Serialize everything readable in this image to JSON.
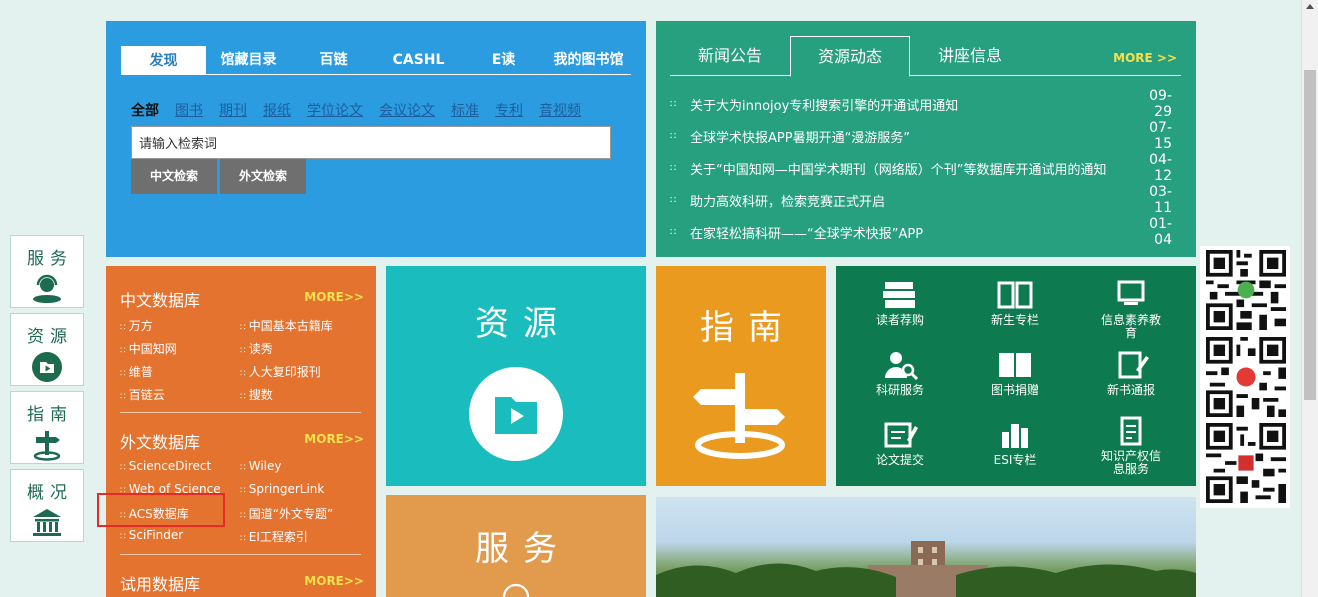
{
  "side_nav": [
    {
      "label": "服务",
      "icon": "service-icon"
    },
    {
      "label": "资源",
      "icon": "resource-icon"
    },
    {
      "label": "指南",
      "icon": "guide-icon"
    },
    {
      "label": "概况",
      "icon": "library-icon"
    }
  ],
  "search": {
    "tabs": [
      "发现",
      "馆藏目录",
      "百链",
      "CASHL",
      "E读",
      "我的图书馆"
    ],
    "types": [
      "全部",
      "图书",
      "期刊",
      "报纸",
      "学位论文",
      "会议论文",
      "标准",
      "专利",
      "音视频"
    ],
    "input_value": "请输入检索词",
    "btn_cn": "中文检索",
    "btn_foreign": "外文检索"
  },
  "news": {
    "tabs": [
      "新闻公告",
      "资源动态",
      "讲座信息"
    ],
    "more": "MORE >>",
    "items": [
      {
        "title": "关于大为innojoy专利搜索引擎的开通试用通知",
        "date": "09-29"
      },
      {
        "title": "全球学术快报APP暑期开通“漫游服务”",
        "date": "07-15"
      },
      {
        "title": "关于“中国知网—中国学术期刊（网络版）个刊”等数据库开通试用的通知",
        "date": "04-12"
      },
      {
        "title": "助力高效科研，检索竞赛正式开启",
        "date": "03-11"
      },
      {
        "title": "在家轻松搞科研——“全球学术快报”APP",
        "date": "01-04"
      }
    ]
  },
  "db": {
    "cn_title": "中文数据库",
    "cn_more": "MORE>>",
    "cn_links": [
      "万方",
      "中国基本古籍库",
      "中国知网",
      "读秀",
      "维普",
      "人大复印报刊",
      "百链云",
      "搜数"
    ],
    "en_title": "外文数据库",
    "en_more": "MORE>>",
    "en_links": [
      "ScienceDirect",
      "Wiley",
      "Web of Science",
      "SpringerLink",
      "ACS数据库",
      "国道“外文专题”",
      "SciFinder",
      "EI工程索引"
    ],
    "trial_title": "试用数据库",
    "trial_more": "MORE>>"
  },
  "tiles": {
    "resource": "资源",
    "guide": "指南",
    "service": "服务"
  },
  "services": [
    {
      "label": "读者荐购",
      "icon": "books-icon"
    },
    {
      "label": "新生专栏",
      "icon": "open-book-icon"
    },
    {
      "label": "信息素养教育",
      "icon": "presentation-icon"
    },
    {
      "label": "科研服务",
      "icon": "research-search-icon"
    },
    {
      "label": "图书捐赠",
      "icon": "book-donate-icon"
    },
    {
      "label": "新书通报",
      "icon": "edit-note-icon"
    },
    {
      "label": "论文提交",
      "icon": "paper-submit-icon"
    },
    {
      "label": "ESI专栏",
      "icon": "building-chart-icon"
    },
    {
      "label": "知识产权信息服务",
      "icon": "document-icon"
    }
  ],
  "colors": {
    "search_bg": "#2b9ce0",
    "news_bg": "#27a07f",
    "db_bg": "#e47330",
    "resource_bg": "#1bbcbd",
    "guide_bg": "#e99a1f",
    "service_grid_bg": "#0e7a4f",
    "more_yellow": "#f4e04c",
    "highlight_red": "#e52a2a"
  }
}
